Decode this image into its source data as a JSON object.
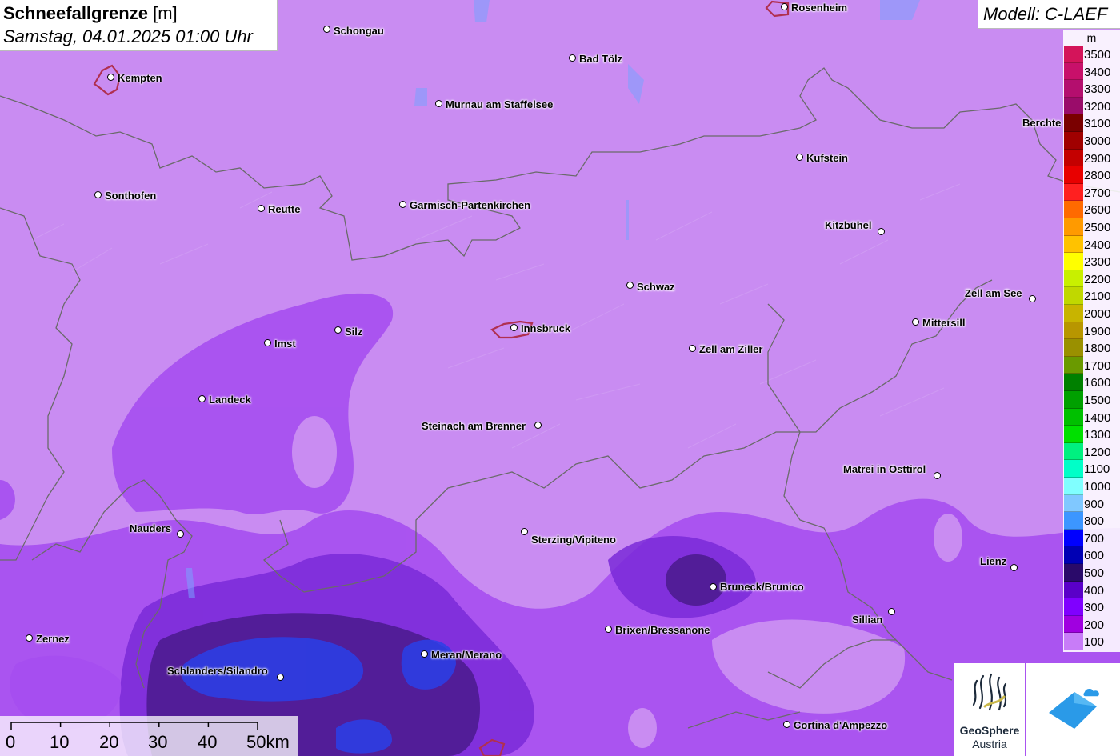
{
  "header": {
    "title_bold": "Schneefallgrenze",
    "title_unit": "[m]",
    "datetime": "Samstag, 04.01.2025 01:00 Uhr"
  },
  "model": {
    "label": "Modell: C-LAEF"
  },
  "legend": {
    "unit": "m",
    "items": [
      {
        "label": "3500",
        "color": "#d4145a"
      },
      {
        "label": "3400",
        "color": "#c8106a"
      },
      {
        "label": "3300",
        "color": "#b40e6e"
      },
      {
        "label": "3200",
        "color": "#9a0c6a"
      },
      {
        "label": "3100",
        "color": "#7a0000"
      },
      {
        "label": "3000",
        "color": "#a00000"
      },
      {
        "label": "2900",
        "color": "#c40000"
      },
      {
        "label": "2800",
        "color": "#e80000"
      },
      {
        "label": "2700",
        "color": "#ff2020"
      },
      {
        "label": "2600",
        "color": "#ff6a00"
      },
      {
        "label": "2500",
        "color": "#ff9a00"
      },
      {
        "label": "2400",
        "color": "#ffc200"
      },
      {
        "label": "2300",
        "color": "#ffff00"
      },
      {
        "label": "2200",
        "color": "#c8f000"
      },
      {
        "label": "2100",
        "color": "#c0d800"
      },
      {
        "label": "2000",
        "color": "#c8b400"
      },
      {
        "label": "1900",
        "color": "#b89600"
      },
      {
        "label": "1800",
        "color": "#9a9000"
      },
      {
        "label": "1700",
        "color": "#6a9a00"
      },
      {
        "label": "1600",
        "color": "#008000"
      },
      {
        "label": "1500",
        "color": "#00a000"
      },
      {
        "label": "1400",
        "color": "#00c000"
      },
      {
        "label": "1300",
        "color": "#00e000"
      },
      {
        "label": "1200",
        "color": "#00f080"
      },
      {
        "label": "1100",
        "color": "#00ffc8"
      },
      {
        "label": "1000",
        "color": "#80ffff"
      },
      {
        "label": "900",
        "color": "#80c8ff"
      },
      {
        "label": "800",
        "color": "#3c96ff"
      },
      {
        "label": "700",
        "color": "#0000ff"
      },
      {
        "label": "600",
        "color": "#0000b4"
      },
      {
        "label": "500",
        "color": "#2a0a6a"
      },
      {
        "label": "400",
        "color": "#5a00c8"
      },
      {
        "label": "300",
        "color": "#8000ff"
      },
      {
        "label": "200",
        "color": "#a000e0"
      },
      {
        "label": "100",
        "color": "#c87cf8"
      }
    ]
  },
  "cities": [
    {
      "name": "Rosenheim"
    },
    {
      "name": "Schongau"
    },
    {
      "name": "Kempten"
    },
    {
      "name": "Bad Tölz"
    },
    {
      "name": "Murnau am Staffelsee"
    },
    {
      "name": "Berchte"
    },
    {
      "name": "Kufstein"
    },
    {
      "name": "Sonthofen"
    },
    {
      "name": "Reutte"
    },
    {
      "name": "Garmisch-Partenkirchen"
    },
    {
      "name": "Kitzbühel"
    },
    {
      "name": "Schwaz"
    },
    {
      "name": "Zell am See"
    },
    {
      "name": "Silz"
    },
    {
      "name": "Innsbruck"
    },
    {
      "name": "Imst"
    },
    {
      "name": "Mittersill"
    },
    {
      "name": "Zell am Ziller"
    },
    {
      "name": "Landeck"
    },
    {
      "name": "Steinach am Brenner"
    },
    {
      "name": "Matrei in Osttirol"
    },
    {
      "name": "Nauders"
    },
    {
      "name": "Sterzing/Vipiteno"
    },
    {
      "name": "Lienz"
    },
    {
      "name": "Bruneck/Brunico"
    },
    {
      "name": "Sillian"
    },
    {
      "name": "Brixen/Bressanone"
    },
    {
      "name": "Zernez"
    },
    {
      "name": "Meran/Merano"
    },
    {
      "name": "Schlanders/Silandro"
    },
    {
      "name": "Cortina d'Ampezzo"
    }
  ],
  "scale": {
    "labels": [
      "0",
      "10",
      "20",
      "30",
      "40",
      "50km"
    ]
  },
  "logo": {
    "line1": "GeoSphere",
    "line2": "Austria"
  },
  "colors": {
    "base_fill": "#c98cf2",
    "mid_fill": "#9a3ee8",
    "dark_fill": "#3a0c6a",
    "blue_fill": "#2a3ce0",
    "border": "#6a6a6a"
  }
}
